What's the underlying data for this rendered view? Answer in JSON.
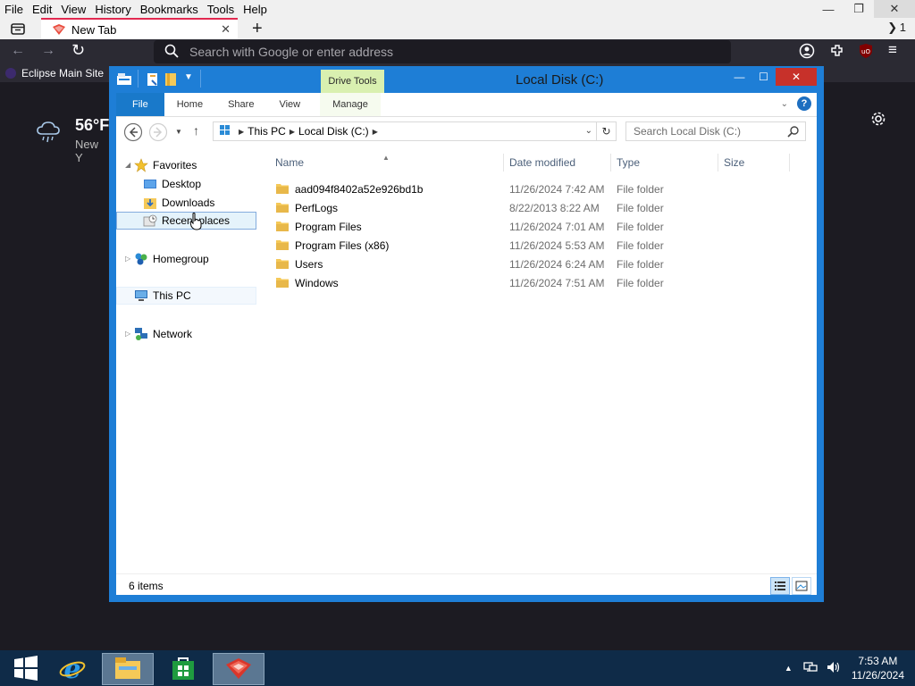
{
  "firefox": {
    "menu": [
      "File",
      "Edit",
      "View",
      "History",
      "Bookmarks",
      "Tools",
      "Help"
    ],
    "tab_title": "New Tab",
    "tab_list_count": "1",
    "url_placeholder": "Search with Google or enter address",
    "bookmark": "Eclipse Main Site",
    "weather_temp": "56°F",
    "weather_loc": "New Y"
  },
  "explorer": {
    "title": "Local Disk (C:)",
    "context_tab": "Drive Tools",
    "ribbon_tabs": [
      "File",
      "Home",
      "Share",
      "View",
      "Manage"
    ],
    "breadcrumb": [
      "This PC",
      "Local Disk (C:)"
    ],
    "search_placeholder": "Search Local Disk (C:)",
    "nav": {
      "favorites": "Favorites",
      "desktop": "Desktop",
      "downloads": "Downloads",
      "recent": "Recent places",
      "homegroup": "Homegroup",
      "thispc": "This PC",
      "network": "Network"
    },
    "columns": [
      "Name",
      "Date modified",
      "Type",
      "Size"
    ],
    "files": [
      {
        "name": "aad094f8402a52e926bd1b",
        "date": "11/26/2024 7:42 AM",
        "type": "File folder"
      },
      {
        "name": "PerfLogs",
        "date": "8/22/2013 8:22 AM",
        "type": "File folder"
      },
      {
        "name": "Program Files",
        "date": "11/26/2024 7:01 AM",
        "type": "File folder"
      },
      {
        "name": "Program Files (x86)",
        "date": "11/26/2024 5:53 AM",
        "type": "File folder"
      },
      {
        "name": "Users",
        "date": "11/26/2024 6:24 AM",
        "type": "File folder"
      },
      {
        "name": "Windows",
        "date": "11/26/2024 7:51 AM",
        "type": "File folder"
      }
    ],
    "status": "6 items"
  },
  "taskbar": {
    "time": "7:53 AM",
    "date": "11/26/2024"
  },
  "colors": {
    "explorer_border": "#1e7ed6",
    "taskbar": "#0f2b48",
    "firefox_dark": "#2b2a33",
    "drive_tools": "#d9f0b0"
  }
}
